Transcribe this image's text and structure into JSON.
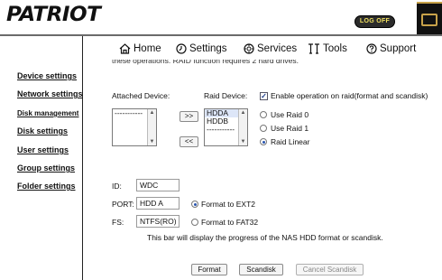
{
  "header": {
    "logo_text": "PATRIOT",
    "logoff_label": "LOG OFF"
  },
  "nav": {
    "home": "Home",
    "settings": "Settings",
    "services": "Services",
    "tools": "Tools",
    "support": "Support"
  },
  "sidebar": {
    "items": [
      {
        "label": "Device settings"
      },
      {
        "label": "Network settings"
      },
      {
        "label": "Disk management"
      },
      {
        "label": "Disk settings"
      },
      {
        "label": "User settings"
      },
      {
        "label": "Group settings"
      },
      {
        "label": "Folder settings"
      }
    ]
  },
  "main": {
    "cut_text": "these operations. RAID function requires 2 hard drives.",
    "attached_label": "Attached Device:",
    "attached_items": [
      "-----------"
    ],
    "raid_label": "Raid Device:",
    "raid_items": [
      "HDDA",
      "HDDB",
      "-----------"
    ],
    "add_button": ">>",
    "remove_button": "<<",
    "enable_raid_label": "Enable operation on raid(format and scandisk)",
    "enable_raid_checked": true,
    "raid_options": [
      "Use Raid 0",
      "Use Raid 1",
      "Raid Linear"
    ],
    "raid_selected": "Raid Linear",
    "id_label": "ID:",
    "id_value": "WDC",
    "port_label": "PORT:",
    "port_value": "HDD A",
    "fs_label": "FS:",
    "fs_value": "NTFS(RO)",
    "format_ext2_label": "Format to EXT2",
    "format_fat32_label": "Format to FAT32",
    "format_selected": "Format to EXT2",
    "progress_text": "This bar will display the progress of the NAS HDD format or scandisk.",
    "format_button": "Format",
    "scandisk_button": "Scandisk",
    "cancel_button": "Cancel Scandisk"
  },
  "colors": {
    "logoff_bg": "#2b2b2b",
    "logoff_text": "#f0e060",
    "radio_accent": "#2a56b0",
    "selection_bg": "#dde6f8"
  }
}
